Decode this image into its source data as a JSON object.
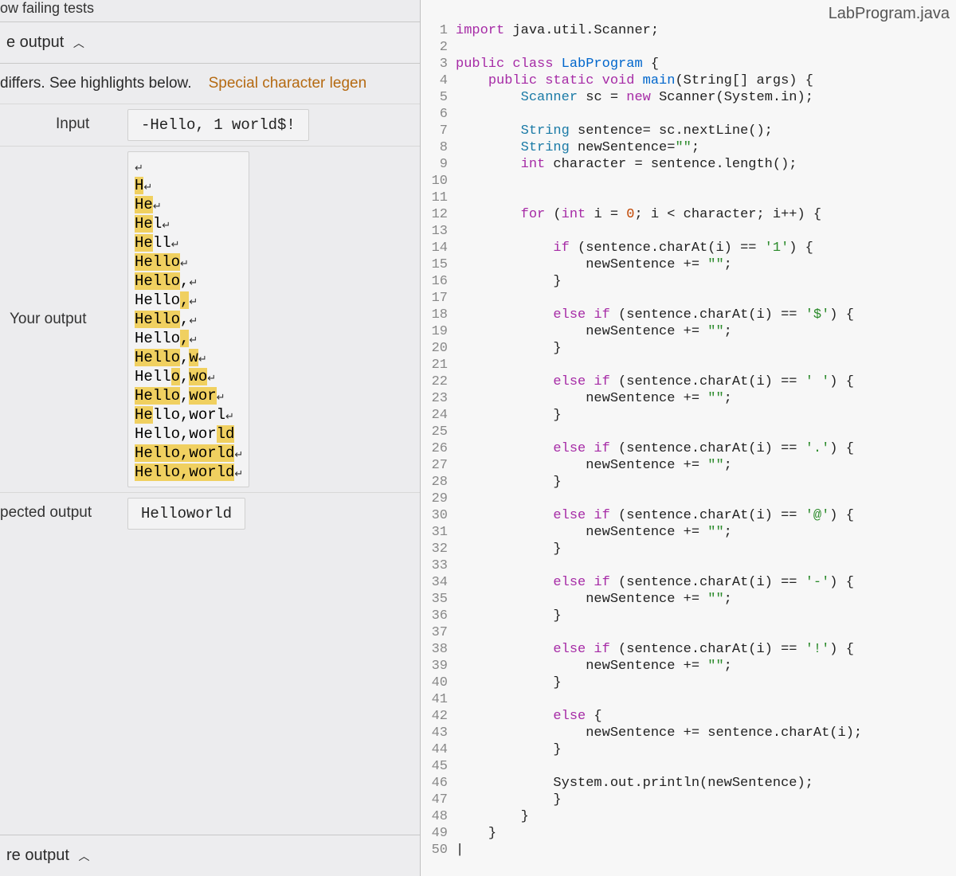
{
  "left": {
    "top_fragment": "ow failing tests",
    "compare_output_label": "e output",
    "differs_text": " differs. See highlights below.",
    "legend_link": "Special character legen",
    "input_label": "Input",
    "input_value": "-Hello, 1 world$!",
    "your_output_label": "Your output",
    "expected_label": "pected output",
    "expected_value": "Helloworld",
    "re_output_label": "re output",
    "lines": [
      [
        {
          "t": "",
          "h": false
        },
        {
          "nl": true
        }
      ],
      [
        {
          "t": "H",
          "h": true
        },
        {
          "nl": true
        }
      ],
      [
        {
          "t": "He",
          "h": true
        },
        {
          "nl": true
        }
      ],
      [
        {
          "t": "He",
          "h": true
        },
        {
          "t": "l",
          "h": false
        },
        {
          "nl": true
        }
      ],
      [
        {
          "t": "He",
          "h": true
        },
        {
          "t": "ll",
          "h": false
        },
        {
          "nl": true
        }
      ],
      [
        {
          "t": "Hello",
          "h": true
        },
        {
          "nl": true
        }
      ],
      [
        {
          "t": "Hello",
          "h": true
        },
        {
          "t": ",",
          "h": false
        },
        {
          "nl": true
        }
      ],
      [
        {
          "t": "Hello",
          "h": false
        },
        {
          "t": ",",
          "h": true
        },
        {
          "nl": true
        }
      ],
      [
        {
          "t": "Hello",
          "h": true
        },
        {
          "t": ",",
          "h": false
        },
        {
          "nl": true
        }
      ],
      [
        {
          "t": "Hello",
          "h": false
        },
        {
          "t": ",",
          "h": true
        },
        {
          "nl": true
        }
      ],
      [
        {
          "t": "Hello",
          "h": true
        },
        {
          "t": ",",
          "h": false
        },
        {
          "t": "w",
          "h": true
        },
        {
          "nl": true
        }
      ],
      [
        {
          "t": "Hell",
          "h": false
        },
        {
          "t": "o",
          "h": true
        },
        {
          "t": ",",
          "h": false
        },
        {
          "t": "wo",
          "h": true
        },
        {
          "nl": true
        }
      ],
      [
        {
          "t": "Hello",
          "h": true
        },
        {
          "t": ",",
          "h": false
        },
        {
          "t": "wor",
          "h": true
        },
        {
          "nl": true
        }
      ],
      [
        {
          "t": "He",
          "h": true
        },
        {
          "t": "llo,worl",
          "h": false
        },
        {
          "nl": true
        }
      ],
      [
        {
          "t": "Hello,wor",
          "h": false
        },
        {
          "t": "ld",
          "h": true
        }
      ],
      [
        {
          "t": "Hello,world",
          "h": true
        },
        {
          "nl": true
        }
      ],
      [
        {
          "t": "Hello,world",
          "h": true
        },
        {
          "nl": true
        }
      ]
    ]
  },
  "right": {
    "filename": "LabProgram.java",
    "code": [
      {
        "n": 1,
        "i": 0,
        "tok": [
          [
            "kw",
            "import"
          ],
          [
            "",
            " java.util.Scanner;"
          ]
        ]
      },
      {
        "n": 2,
        "i": 0,
        "tok": []
      },
      {
        "n": 3,
        "i": 0,
        "tok": [
          [
            "kw",
            "public class"
          ],
          [
            "",
            " "
          ],
          [
            "cls",
            "LabProgram"
          ],
          [
            "",
            " {"
          ]
        ]
      },
      {
        "n": 4,
        "i": 1,
        "tok": [
          [
            "kw",
            "public static void"
          ],
          [
            "",
            " "
          ],
          [
            "cls",
            "main"
          ],
          [
            "",
            "(String[] args) {"
          ]
        ]
      },
      {
        "n": 5,
        "i": 2,
        "tok": [
          [
            "typ",
            "Scanner"
          ],
          [
            "",
            " sc = "
          ],
          [
            "kw",
            "new"
          ],
          [
            "",
            " Scanner(System.in);"
          ]
        ]
      },
      {
        "n": 6,
        "i": 0,
        "tok": []
      },
      {
        "n": 7,
        "i": 2,
        "tok": [
          [
            "typ",
            "String"
          ],
          [
            "",
            " sentence= sc.nextLine();"
          ]
        ]
      },
      {
        "n": 8,
        "i": 2,
        "tok": [
          [
            "typ",
            "String"
          ],
          [
            "",
            " newSentence="
          ],
          [
            "str",
            "\"\""
          ],
          [
            "",
            ";"
          ]
        ]
      },
      {
        "n": 9,
        "i": 2,
        "tok": [
          [
            "kw",
            "int"
          ],
          [
            "",
            " character = sentence.length();"
          ]
        ]
      },
      {
        "n": 10,
        "i": 0,
        "tok": []
      },
      {
        "n": 11,
        "i": 0,
        "tok": []
      },
      {
        "n": 12,
        "i": 2,
        "tok": [
          [
            "kw",
            "for"
          ],
          [
            "",
            " ("
          ],
          [
            "kw",
            "int"
          ],
          [
            "",
            " i = "
          ],
          [
            "num",
            "0"
          ],
          [
            "",
            "; i < character; i++) {"
          ]
        ]
      },
      {
        "n": 13,
        "i": 0,
        "tok": []
      },
      {
        "n": 14,
        "i": 3,
        "tok": [
          [
            "kw",
            "if"
          ],
          [
            "",
            " (sentence.charAt(i) == "
          ],
          [
            "str",
            "'1'"
          ],
          [
            "",
            ") {"
          ]
        ]
      },
      {
        "n": 15,
        "i": 4,
        "tok": [
          [
            "",
            "newSentence += "
          ],
          [
            "str",
            "\"\""
          ],
          [
            "",
            ";"
          ]
        ]
      },
      {
        "n": 16,
        "i": 3,
        "tok": [
          [
            "",
            "}"
          ]
        ]
      },
      {
        "n": 17,
        "i": 0,
        "tok": []
      },
      {
        "n": 18,
        "i": 3,
        "tok": [
          [
            "kw",
            "else if"
          ],
          [
            "",
            " (sentence.charAt(i) == "
          ],
          [
            "str",
            "'$'"
          ],
          [
            "",
            ") {"
          ]
        ]
      },
      {
        "n": 19,
        "i": 4,
        "tok": [
          [
            "",
            "newSentence += "
          ],
          [
            "str",
            "\"\""
          ],
          [
            "",
            ";"
          ]
        ]
      },
      {
        "n": 20,
        "i": 3,
        "tok": [
          [
            "",
            "}"
          ]
        ]
      },
      {
        "n": 21,
        "i": 0,
        "tok": []
      },
      {
        "n": 22,
        "i": 3,
        "tok": [
          [
            "kw",
            "else if"
          ],
          [
            "",
            " (sentence.charAt(i) == "
          ],
          [
            "str",
            "' '"
          ],
          [
            "",
            ") {"
          ]
        ]
      },
      {
        "n": 23,
        "i": 4,
        "tok": [
          [
            "",
            "newSentence += "
          ],
          [
            "str",
            "\"\""
          ],
          [
            "",
            ";"
          ]
        ]
      },
      {
        "n": 24,
        "i": 3,
        "tok": [
          [
            "",
            "}"
          ]
        ]
      },
      {
        "n": 25,
        "i": 0,
        "tok": []
      },
      {
        "n": 26,
        "i": 3,
        "tok": [
          [
            "kw",
            "else if"
          ],
          [
            "",
            " (sentence.charAt(i) == "
          ],
          [
            "str",
            "'.'"
          ],
          [
            "",
            ") {"
          ]
        ]
      },
      {
        "n": 27,
        "i": 4,
        "tok": [
          [
            "",
            "newSentence += "
          ],
          [
            "str",
            "\"\""
          ],
          [
            "",
            ";"
          ]
        ]
      },
      {
        "n": 28,
        "i": 3,
        "tok": [
          [
            "",
            "}"
          ]
        ]
      },
      {
        "n": 29,
        "i": 0,
        "tok": []
      },
      {
        "n": 30,
        "i": 3,
        "tok": [
          [
            "kw",
            "else if"
          ],
          [
            "",
            " (sentence.charAt(i) == "
          ],
          [
            "str",
            "'@'"
          ],
          [
            "",
            ") {"
          ]
        ]
      },
      {
        "n": 31,
        "i": 4,
        "tok": [
          [
            "",
            "newSentence += "
          ],
          [
            "str",
            "\"\""
          ],
          [
            "",
            ";"
          ]
        ]
      },
      {
        "n": 32,
        "i": 3,
        "tok": [
          [
            "",
            "}"
          ]
        ]
      },
      {
        "n": 33,
        "i": 0,
        "tok": []
      },
      {
        "n": 34,
        "i": 3,
        "tok": [
          [
            "kw",
            "else if"
          ],
          [
            "",
            " (sentence.charAt(i) == "
          ],
          [
            "str",
            "'-'"
          ],
          [
            "",
            ") {"
          ]
        ]
      },
      {
        "n": 35,
        "i": 4,
        "tok": [
          [
            "",
            "newSentence += "
          ],
          [
            "str",
            "\"\""
          ],
          [
            "",
            ";"
          ]
        ]
      },
      {
        "n": 36,
        "i": 3,
        "tok": [
          [
            "",
            "}"
          ]
        ]
      },
      {
        "n": 37,
        "i": 0,
        "tok": []
      },
      {
        "n": 38,
        "i": 3,
        "tok": [
          [
            "kw",
            "else if"
          ],
          [
            "",
            " (sentence.charAt(i) == "
          ],
          [
            "str",
            "'!'"
          ],
          [
            "",
            ") {"
          ]
        ]
      },
      {
        "n": 39,
        "i": 4,
        "tok": [
          [
            "",
            "newSentence += "
          ],
          [
            "str",
            "\"\""
          ],
          [
            "",
            ";"
          ]
        ]
      },
      {
        "n": 40,
        "i": 3,
        "tok": [
          [
            "",
            "}"
          ]
        ]
      },
      {
        "n": 41,
        "i": 0,
        "tok": []
      },
      {
        "n": 42,
        "i": 3,
        "tok": [
          [
            "kw",
            "else"
          ],
          [
            "",
            " {"
          ]
        ]
      },
      {
        "n": 43,
        "i": 4,
        "tok": [
          [
            "",
            "newSentence += sentence.charAt(i);"
          ]
        ]
      },
      {
        "n": 44,
        "i": 3,
        "tok": [
          [
            "",
            "}"
          ]
        ]
      },
      {
        "n": 45,
        "i": 0,
        "tok": []
      },
      {
        "n": 46,
        "i": 3,
        "tok": [
          [
            "",
            "System.out.println(newSentence);"
          ]
        ]
      },
      {
        "n": 47,
        "i": 3,
        "tok": [
          [
            "",
            "}"
          ]
        ]
      },
      {
        "n": 48,
        "i": 2,
        "tok": [
          [
            "",
            "}"
          ]
        ]
      },
      {
        "n": 49,
        "i": 1,
        "tok": [
          [
            "",
            "}"
          ]
        ]
      },
      {
        "n": 50,
        "i": 0,
        "tok": [
          [
            "",
            "|"
          ]
        ]
      }
    ]
  }
}
